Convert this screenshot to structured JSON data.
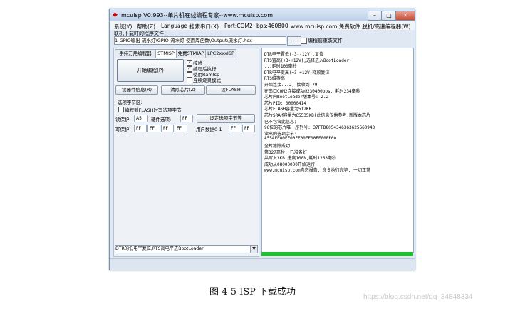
{
  "window": {
    "title": "mcuisp V0.993--单片机在线编程专家--www.mcuisp.com",
    "min": "–",
    "max": "□",
    "close": "✕"
  },
  "menu": {
    "items": [
      "系统(Y)",
      "帮助(Z)",
      "Language",
      "搜索串口(X)",
      "Port:COM2",
      "bps:460800"
    ],
    "site": "www.mcuisp.com 免费软件 脱机/高速编程器(W)"
  },
  "file": {
    "label": "联机下载时的程序文件：",
    "path": "1-GPIO输出-流水灯\\GPIO-流水灯-使用库函数\\Output\\流水灯.hex",
    "browse": "...",
    "reload_label": "编程前重装文件"
  },
  "tabs": [
    "手持万用编程器",
    "STMISP",
    "免费STMIAP",
    "LPC2xxxISP"
  ],
  "left": {
    "start_button": "开始编程(P)",
    "options": [
      {
        "label": "校验",
        "checked": true
      },
      {
        "label": "编程后执行",
        "checked": true
      },
      {
        "label": "使用RamIsp",
        "checked": false
      },
      {
        "label": "连续烧录模式",
        "checked": false
      }
    ],
    "read_info": "读器件信息(R)",
    "erase": "清除芯片(Z)",
    "read_flash": "读FLASH",
    "option_title": "选项字节区:",
    "option_chk": "编程到FLASH时写选项字节",
    "read_prot": "读保护:",
    "read_prot_val": "A5",
    "hw_opt": "硬件选项:",
    "hw_opt_val": "FF",
    "set_opt_btn": "设定选项字节等",
    "write_prot": "写保护:",
    "write_prot_vals": [
      "FF",
      "FF",
      "FF",
      "FF"
    ],
    "user_data": "用户数据0-1",
    "user_data_vals": [
      "FF",
      "FF"
    ],
    "boot_select": "DTR的低电平复位,RTS高电平进BootLoader",
    "arrow": "▼"
  },
  "log": [
    "DTR电平置低(-3--12V),复位",
    "RTS置高(+3-+12V),选择进入BootLoader",
    "...延时100毫秒",
    "DTR电平变高(+3-+12V)释放复位",
    "RTS维持高",
    "开始连接...2, 接收到:79",
    "在串口COM2连接成功@230400bps, 耗时234毫秒",
    "芯片内BootLoader版本号: 2.2",
    "芯片PID: 00000414",
    "芯片FLASH容量为512KB",
    "芯片SRAM容量为65535KB(此信息仅供参考,新版本芯片",
    "已不包含此信息)",
    "96位的芯片唯一序列号: 37FFD8054346363625660943",
    "读出的选项字节:",
    "A55AFF00FF00FF00FF00FF00FF00",
    "全片擦除成功",
    "第327毫秒, 已准备好",
    "共写入3KB,进度100%,耗时1263毫秒",
    "成功从08000000开始运行",
    "www.mcuisp.com向您报告, 命令执行完毕, 一切正常"
  ],
  "progress": 1.0,
  "caption": "图 4-5 ISP 下载成功",
  "watermark": "https://blog.csdn.net/qq_34848334"
}
